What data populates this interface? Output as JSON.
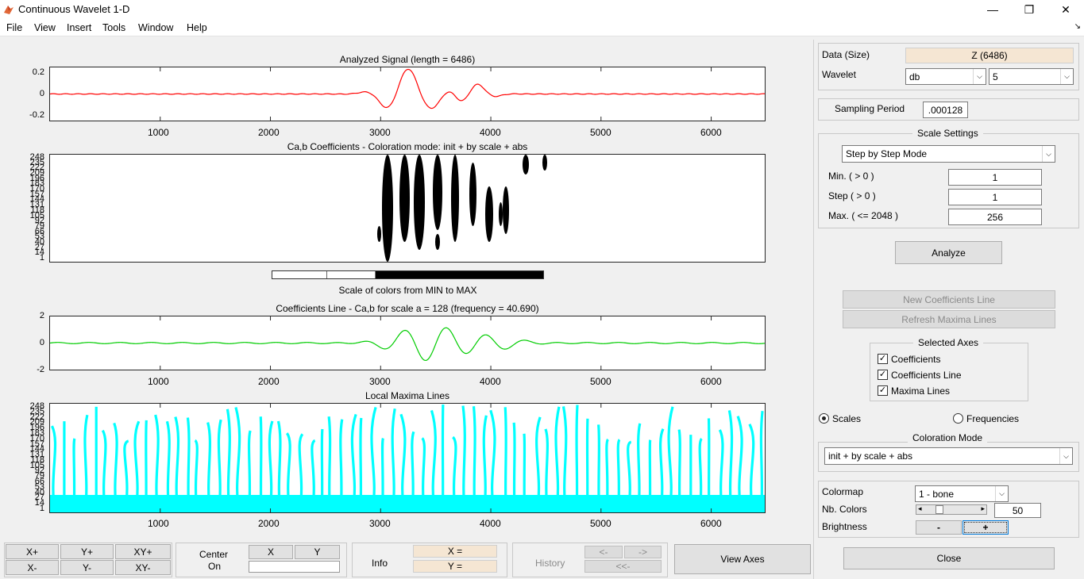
{
  "window": {
    "title": "Continuous Wavelet 1-D",
    "minimize": "—",
    "maximize": "❐",
    "close": "✕",
    "undock": "↘"
  },
  "menu": [
    "File",
    "View",
    "Insert",
    "Tools",
    "Window",
    "Help"
  ],
  "plots": {
    "signal": {
      "title": "Analyzed Signal (length = 6486)",
      "yticks": [
        "0.2",
        "0",
        "-0.2"
      ],
      "xticks": [
        "1000",
        "2000",
        "3000",
        "4000",
        "5000",
        "6000"
      ],
      "line_color": "#ff0000"
    },
    "coeffs": {
      "title": "Ca,b Coefficients - Coloration mode: init + by scale + abs",
      "yticks": [
        "248",
        "235",
        "222",
        "209",
        "196",
        "183",
        "170",
        "157",
        "144",
        "131",
        "118",
        "105",
        "92",
        "79",
        "66",
        "53",
        "40",
        "27",
        "14",
        "1"
      ]
    },
    "colorbar": {
      "label": "Scale of colors from MIN to MAX"
    },
    "coef_line": {
      "title": "Coefficients Line - Ca,b for scale a = 128  (frequency =  40.690)",
      "yticks": [
        "2",
        "0",
        "-2"
      ],
      "xticks": [
        "1000",
        "2000",
        "3000",
        "4000",
        "5000",
        "6000"
      ],
      "line_color": "#00cc00"
    },
    "maxima": {
      "title": "Local Maxima Lines",
      "yticks": [
        "248",
        "235",
        "222",
        "209",
        "196",
        "183",
        "170",
        "157",
        "144",
        "131",
        "118",
        "105",
        "92",
        "79",
        "66",
        "53",
        "40",
        "27",
        "14",
        "1"
      ],
      "xticks": [
        "1000",
        "2000",
        "3000",
        "4000",
        "5000",
        "6000"
      ],
      "line_color": "#00ffff"
    }
  },
  "panel": {
    "data_label": "Data  (Size)",
    "data_value": "Z  (6486)",
    "wavelet_label": "Wavelet",
    "wavelet_family": "db",
    "wavelet_order": "5",
    "sampling_label": "Sampling Period",
    "sampling_value": ".000128",
    "scale_settings_label": "Scale Settings",
    "scale_mode": "Step by Step Mode",
    "min_label": "Min. ( > 0 )",
    "min_value": "1",
    "step_label": "Step ( > 0 )",
    "step_value": "1",
    "max_label": "Max. ( <= 2048 )",
    "max_value": "256",
    "analyze": "Analyze",
    "new_coef_line": "New Coefficients Line",
    "refresh_maxima": "Refresh Maxima Lines",
    "selected_axes_label": "Selected Axes",
    "axes_options": [
      {
        "label": "Coefficients",
        "checked": true
      },
      {
        "label": "Coefficients Line",
        "checked": true
      },
      {
        "label": "Maxima Lines",
        "checked": true
      }
    ],
    "scales_label": "Scales",
    "frequencies_label": "Frequencies",
    "coloration_label": "Coloration Mode",
    "coloration_value": "init + by scale + abs",
    "colormap_label": "Colormap",
    "colormap_value": "1 - bone",
    "nb_colors_label": "Nb. Colors",
    "nb_colors_value": "50",
    "nb_colors_slider": 0.2,
    "brightness_label": "Brightness",
    "brightness_minus": "-",
    "brightness_plus": "+",
    "close": "Close"
  },
  "bottom": {
    "xplus": "X+",
    "yplus": "Y+",
    "xyplus": "XY+",
    "xminus": "X-",
    "yminus": "Y-",
    "xyminus": "XY-",
    "center_on": "Center",
    "center_on2": "On",
    "center_x": "X",
    "center_y": "Y",
    "info": "Info",
    "info_x": "X =",
    "info_y": "Y =",
    "history": "History",
    "hist_back": "<-",
    "hist_fwd": "->",
    "hist_first": "<<-",
    "view_axes": "View Axes"
  }
}
